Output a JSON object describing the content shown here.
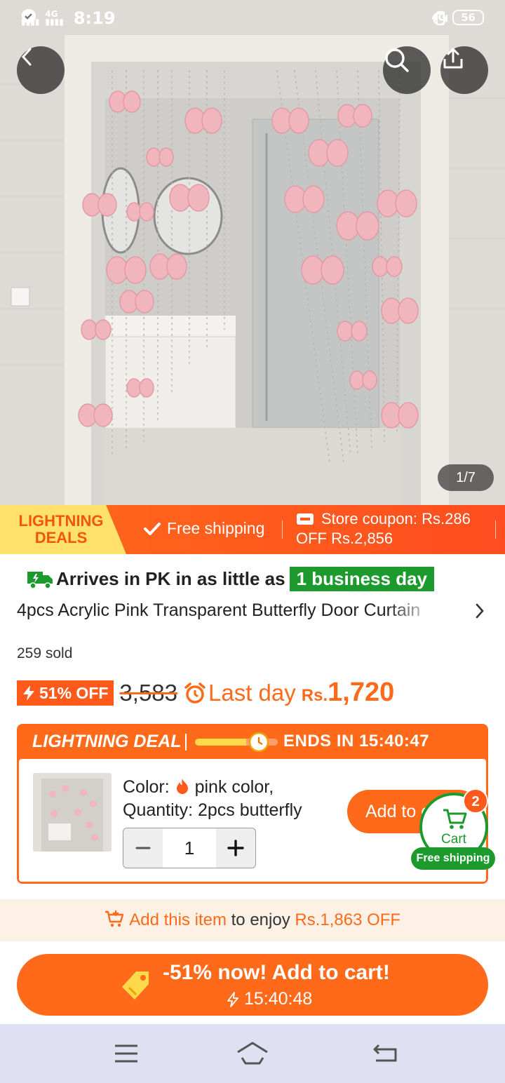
{
  "status_bar": {
    "signal_1": "4G",
    "signal_2": "4G",
    "time": "8:19",
    "network": "4G",
    "battery": "56"
  },
  "gallery": {
    "counter": "1/7"
  },
  "promo_banner": {
    "badge_line1": "LIGHTNING",
    "badge_line2": "DEALS",
    "free_shipping": "Free shipping",
    "coupon_line1": "Store coupon: Rs.286",
    "coupon_line2": "OFF Rs.2,856"
  },
  "product": {
    "arrives_text": "Arrives in PK in as little as",
    "arrives_highlight": "1 business day",
    "title": "4pcs Acrylic Pink Transparent Butterfly Door Curtain",
    "sold": "259 sold",
    "discount_badge": "51% OFF",
    "old_price": "3,583",
    "last_day": "Last day",
    "currency": "Rs.",
    "price": "1,720"
  },
  "lightning_deal": {
    "label": "LIGHTNING DEAL",
    "ends_label": "ENDS IN",
    "countdown": "15:40:47",
    "progress": 0.62,
    "color_label": "Color:",
    "color_value": "pink color,",
    "quantity_line": "Quantity: 2pcs butterfly",
    "quantity": "1",
    "add_button": "Add to cart"
  },
  "cart": {
    "label": "Cart",
    "count": "2",
    "free_shipping": "Free shipping"
  },
  "add_strip": {
    "link": "Add this item",
    "middle": "to enjoy",
    "amount": "Rs.1,863 OFF"
  },
  "cta": {
    "line1": "-51% now! Add to cart!",
    "timer": "15:40:48"
  },
  "colors": {
    "accent": "#ff6a1a",
    "green": "#1d9a2e",
    "yellow": "#ffe16b"
  }
}
